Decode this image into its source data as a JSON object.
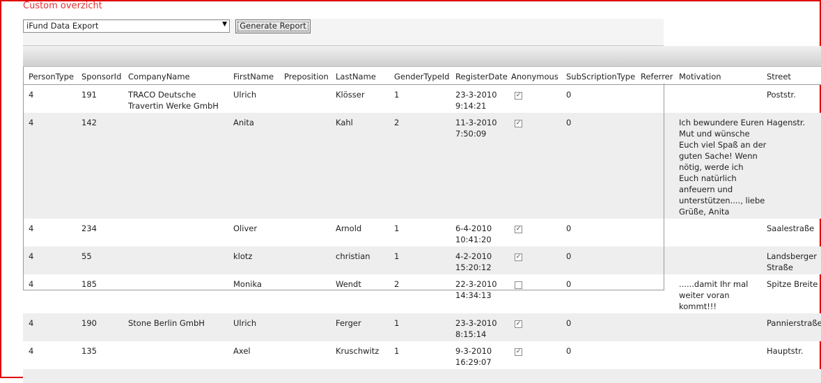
{
  "page": {
    "title": "Custom overzicht"
  },
  "toolbar": {
    "report_select_value": "iFund Data Export",
    "generate_button_label": "Generate Report"
  },
  "grid": {
    "columns": [
      "PersonType",
      "SponsorId",
      "CompanyName",
      "FirstName",
      "Preposition",
      "LastName",
      "GenderTypeId",
      "RegisterDate",
      "Anonymous",
      "SubScriptionType",
      "Referrer",
      "Motivation",
      "Street"
    ],
    "rows": [
      {
        "person_type": "4",
        "sponsor_id": "191",
        "company_line1": "TRACO Deutsche",
        "company_line2": "Travertin Werke GmbH",
        "first_name": "Ulrich",
        "last_name": "Klösser",
        "gender": "1",
        "date": "23-3-2010",
        "time": "9:14:21",
        "anonymous": "checked",
        "subscription": "0",
        "motivation": [],
        "street_line1": "Poststr.",
        "street_line2": ""
      },
      {
        "person_type": "4",
        "sponsor_id": "142",
        "company_line1": "",
        "company_line2": "",
        "first_name": "Anita",
        "last_name": "Kahl",
        "gender": "2",
        "date": "11-3-2010",
        "time": "7:50:09",
        "anonymous": "checked",
        "subscription": "0",
        "motivation": [
          "Ich bewundere Euren",
          "Mut und wünsche",
          "Euch viel Spaß an der",
          "guten Sache! Wenn",
          "nötig, werde ich",
          "Euch natürlich",
          "anfeuern und",
          "unterstützen...., liebe",
          "Grüße, Anita"
        ],
        "street_line1": "Hagenstr.",
        "street_line2": ""
      },
      {
        "person_type": "4",
        "sponsor_id": "234",
        "company_line1": "",
        "company_line2": "",
        "first_name": "Oliver",
        "last_name": "Arnold",
        "gender": "1",
        "date": "6-4-2010",
        "time": "10:41:20",
        "anonymous": "checked",
        "subscription": "0",
        "motivation": [],
        "street_line1": "Saalestraße",
        "street_line2": ""
      },
      {
        "person_type": "4",
        "sponsor_id": "55",
        "company_line1": "",
        "company_line2": "",
        "first_name": "klotz",
        "last_name": "christian",
        "gender": "1",
        "date": "4-2-2010",
        "time": "15:20:12",
        "anonymous": "checked",
        "subscription": "0",
        "motivation": [],
        "street_line1": "Landsberger",
        "street_line2": "Straße"
      },
      {
        "person_type": "4",
        "sponsor_id": "185",
        "company_line1": "",
        "company_line2": "",
        "first_name": "Monika",
        "last_name": "Wendt",
        "gender": "2",
        "date": "22-3-2010",
        "time": "14:34:13",
        "anonymous": "unchecked",
        "subscription": "0",
        "motivation": [
          "......damit Ihr mal",
          "weiter voran",
          "kommt!!!"
        ],
        "street_line1": "Spitze Breite",
        "street_line2": ""
      },
      {
        "person_type": "4",
        "sponsor_id": "190",
        "company_line1": "Stone Berlin GmbH",
        "company_line2": "",
        "first_name": "Ulrich",
        "last_name": "Ferger",
        "gender": "1",
        "date": "23-3-2010",
        "time": "8:15:14",
        "anonymous": "checked",
        "subscription": "0",
        "motivation": [],
        "street_line1": "Pannierstraße",
        "street_line2": ""
      },
      {
        "person_type": "4",
        "sponsor_id": "135",
        "company_line1": "",
        "company_line2": "",
        "first_name": "Axel",
        "last_name": "Kruschwitz",
        "gender": "1",
        "date": "9-3-2010",
        "time": "16:29:07",
        "anonymous": "checked",
        "subscription": "0",
        "motivation": [],
        "street_line1": "Hauptstr.",
        "street_line2": ""
      }
    ]
  }
}
